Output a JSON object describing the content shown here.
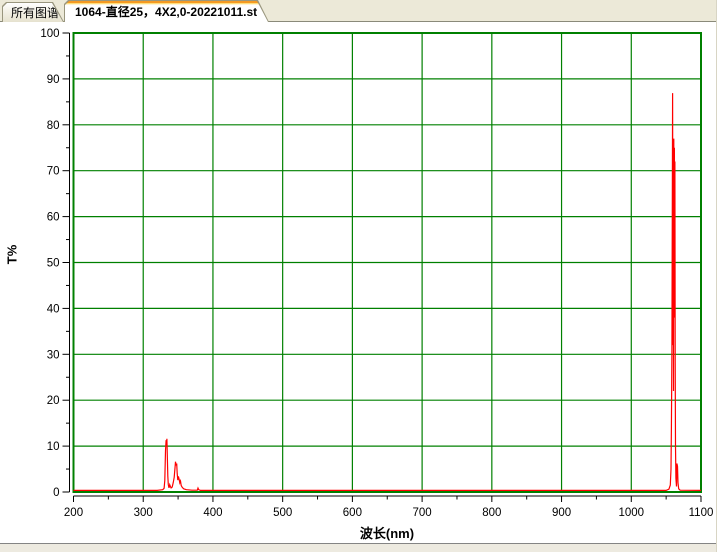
{
  "tabs": {
    "items": [
      {
        "label": "所有图谱",
        "active": false
      },
      {
        "label": "1064-直径25，4X2,0-20221011.st",
        "active": true
      }
    ]
  },
  "chart_data": {
    "type": "line",
    "title": "",
    "xlabel": "波长(nm)",
    "ylabel": "T%",
    "xlim": [
      200,
      1100
    ],
    "ylim": [
      0,
      100
    ],
    "x_major_ticks": [
      200,
      300,
      400,
      500,
      600,
      700,
      800,
      900,
      1000,
      1100
    ],
    "x_minor_ticks": [
      250,
      350,
      450,
      550,
      650,
      750,
      850,
      950,
      1050
    ],
    "y_major_ticks": [
      0,
      10,
      20,
      30,
      40,
      50,
      60,
      70,
      80,
      90,
      100
    ],
    "y_minor_ticks": [
      5,
      15,
      25,
      35,
      45,
      55,
      65,
      75,
      85,
      95
    ],
    "grid": true,
    "legend": "none",
    "series": [
      {
        "name": "T%",
        "color": "#ff0000",
        "points": [
          [
            200,
            0.35
          ],
          [
            320,
            0.35
          ],
          [
            328,
            0.5
          ],
          [
            330,
            0.8
          ],
          [
            331,
            2.5
          ],
          [
            332,
            9.0
          ],
          [
            332.8,
            11.3
          ],
          [
            333.5,
            10.5
          ],
          [
            334,
            11.6
          ],
          [
            334.6,
            8.0
          ],
          [
            335.3,
            3.5
          ],
          [
            336,
            1.6
          ],
          [
            337,
            0.9
          ],
          [
            338,
            1.6
          ],
          [
            339,
            1.2
          ],
          [
            340,
            0.9
          ],
          [
            341.5,
            1.1
          ],
          [
            343,
            2.0
          ],
          [
            344.5,
            3.2
          ],
          [
            345.5,
            5.0
          ],
          [
            346.3,
            6.6
          ],
          [
            347.2,
            5.8
          ],
          [
            348,
            6.2
          ],
          [
            348.8,
            4.0
          ],
          [
            349.6,
            2.6
          ],
          [
            350.5,
            3.4
          ],
          [
            351.5,
            2.8
          ],
          [
            352.5,
            2.0
          ],
          [
            353.5,
            2.4
          ],
          [
            354.5,
            1.4
          ],
          [
            356,
            1.0
          ],
          [
            358,
            0.7
          ],
          [
            362,
            0.5
          ],
          [
            370,
            0.4
          ],
          [
            377.5,
            0.4
          ],
          [
            378.5,
            0.85
          ],
          [
            379.5,
            0.5
          ],
          [
            382,
            0.35
          ],
          [
            1050,
            0.35
          ],
          [
            1054,
            0.6
          ],
          [
            1056,
            1.5
          ],
          [
            1057,
            5.0
          ],
          [
            1057.6,
            14
          ],
          [
            1058.2,
            30
          ],
          [
            1058.8,
            62
          ],
          [
            1059.3,
            86.9
          ],
          [
            1059.8,
            32
          ],
          [
            1060.2,
            68
          ],
          [
            1060.6,
            22
          ],
          [
            1061,
            77
          ],
          [
            1061.4,
            38
          ],
          [
            1061.8,
            75
          ],
          [
            1062.2,
            52
          ],
          [
            1062.6,
            72
          ],
          [
            1063,
            28
          ],
          [
            1063.4,
            10
          ],
          [
            1064,
            3.0
          ],
          [
            1064.8,
            1.2
          ],
          [
            1065.5,
            6.2
          ],
          [
            1066.3,
            5.6
          ],
          [
            1067,
            2.0
          ],
          [
            1068,
            0.7
          ],
          [
            1070,
            0.4
          ],
          [
            1100,
            0.35
          ]
        ]
      }
    ]
  },
  "colors": {
    "grid_green": "#008000",
    "curve_red": "#ff0000",
    "axis_black": "#000000",
    "tabbar_bg": "#ece9d8",
    "active_tab_highlight": "#f59a23",
    "window_edge": "#848484"
  }
}
